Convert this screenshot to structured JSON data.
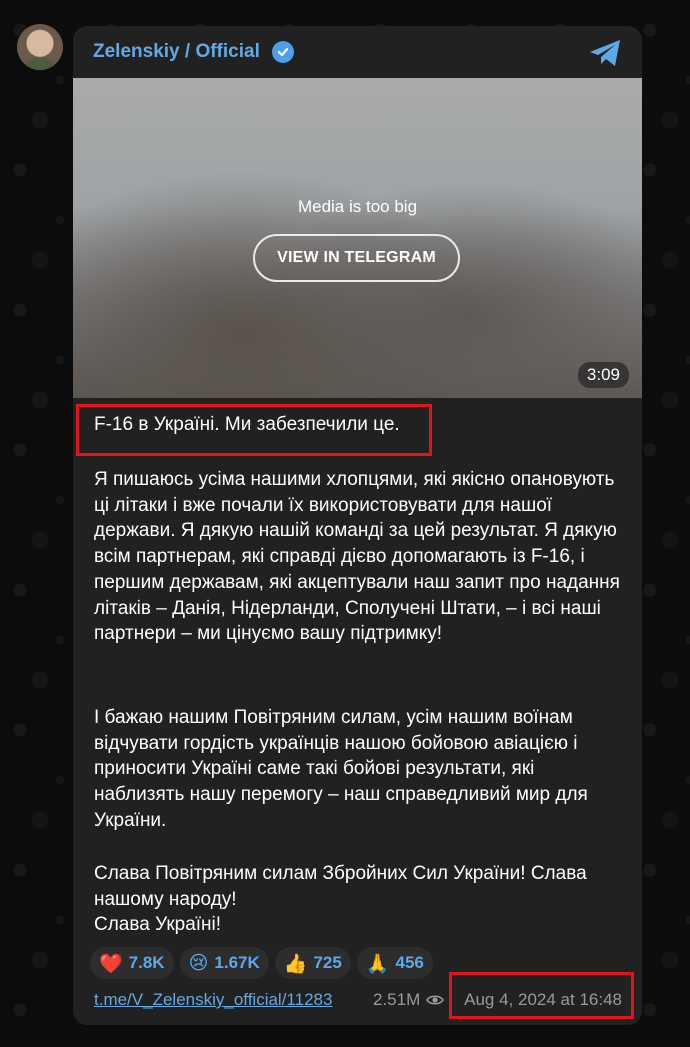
{
  "channel": {
    "name": "Zelenskiy / Official"
  },
  "media": {
    "message": "Media is too big",
    "button_label": "VIEW IN TELEGRAM",
    "duration": "3:09"
  },
  "post": {
    "paragraphs": [
      "F-16 в Україні. Ми забезпечили це.",
      "Я пишаюсь усіма нашими хлопцями, які якісно опановують ці літаки і вже почали їх використовувати для нашої держави. Я дякую нашій команді за цей результат. Я дякую всім партнерам, які справді дієво допомагають із F-16, і першим державам, які акцептували наш запит про надання літаків – Данія, Нідерланди, Сполучені Штати, – і всі наші партнери – ми цінуємо вашу підтримку!",
      "І бажаю нашим Повітряним силам, усім нашим воїнам відчувати гордість українців нашою бойовою авіацією і приносити Україні саме такі бойові результати, які наблизять нашу перемогу – наш справедливий мир для України.",
      "Слава Повітряним силам Збройних Сил України! Слава нашому народу!\nСлава Україні!"
    ]
  },
  "reactions": [
    {
      "emoji": "❤️",
      "icon": "heart-icon",
      "count": "7.8K"
    },
    {
      "emoji": "😢",
      "icon": "crying-face-icon",
      "count": "1.67K"
    },
    {
      "emoji": "👍",
      "icon": "thumbs-up-icon",
      "count": "725"
    },
    {
      "emoji": "🙏",
      "icon": "folded-hands-icon",
      "count": "456"
    }
  ],
  "footer": {
    "link": "t.me/V_Zelenskiy_official/11283",
    "views": "2.51M",
    "date": "Aug 4, 2024 at 16:48"
  },
  "colors": {
    "accent": "#66a8e2",
    "highlight_box": "#e0141b",
    "card_bg": "#212121"
  }
}
